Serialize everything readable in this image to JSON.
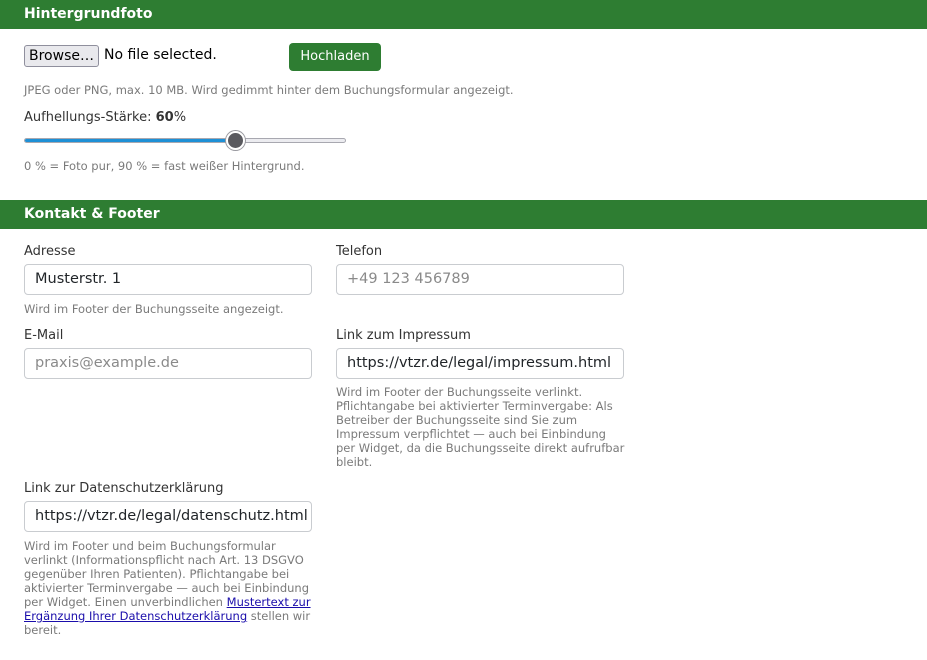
{
  "background_photo": {
    "header": "Hintergrundfoto",
    "browse_label": "Browse…",
    "file_status": "No file selected.",
    "upload_label": "Hochladen",
    "format_hint": "JPEG oder PNG, max. 10 MB. Wird gedimmt hinter dem Buchungsformular angezeigt.",
    "brightness_label": "Aufhellungs-Stärke:",
    "brightness_value": "60",
    "brightness_unit": "%",
    "slider_fraction": 0.667,
    "slider_hint": "0 % = Foto pur, 90 % = fast weißer Hintergrund."
  },
  "contact_footer": {
    "header": "Kontakt & Footer",
    "address": {
      "label": "Adresse",
      "value": "Musterstr. 1",
      "hint": "Wird im Footer der Buchungsseite angezeigt."
    },
    "phone": {
      "label": "Telefon",
      "placeholder": "+49 123 456789"
    },
    "email": {
      "label": "E-Mail",
      "placeholder": "praxis@example.de"
    },
    "imprint": {
      "label": "Link zum Impressum",
      "value": "https://vtzr.de/legal/impressum.html",
      "hint": "Wird im Footer der Buchungsseite verlinkt. Pflichtangabe bei aktivierter Terminvergabe: Als Betreiber der Buchungsseite sind Sie zum Impressum verpflichtet — auch bei Einbindung per Widget, da die Buchungsseite direkt aufrufbar bleibt."
    },
    "privacy": {
      "label": "Link zur Datenschutzerklärung",
      "value": "https://vtzr.de/legal/datenschutz.html",
      "hint_before": "Wird im Footer und beim Buchungsformular verlinkt (Informationspflicht nach Art. 13 DSGVO gegenüber Ihren Patienten). Pflichtangabe bei aktivierter Terminvergabe — auch bei Einbindung per Widget. Einen unverbindlichen ",
      "hint_link": "Mustertext zur Ergänzung Ihrer Datenschutzerklärung",
      "hint_after": " stellen wir bereit."
    }
  },
  "colors": {
    "header_bg": "#2e7d32",
    "button_bg": "#2e7d32",
    "slider_fill": "#1e90d6"
  }
}
